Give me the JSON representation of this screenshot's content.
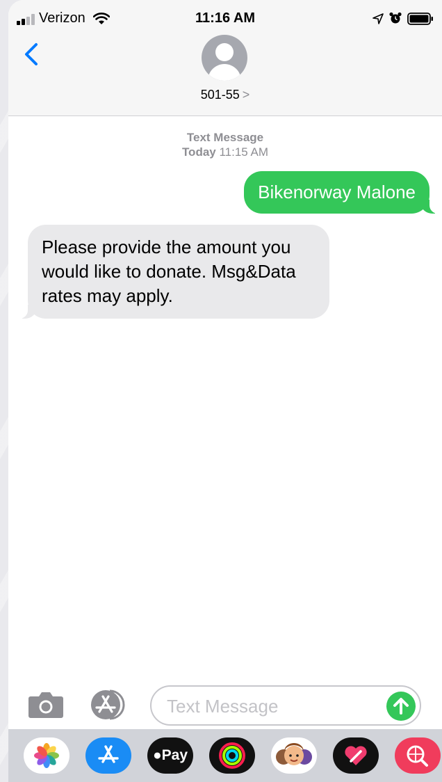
{
  "status_bar": {
    "carrier": "Verizon",
    "time": "11:16 AM"
  },
  "header": {
    "contact": "501-55",
    "chevron": ">"
  },
  "thread": {
    "service_label": "Text Message",
    "day_label": "Today",
    "timestamp": "11:15 AM",
    "messages": [
      {
        "direction": "sent",
        "text": "Bikenorway Malone"
      },
      {
        "direction": "received",
        "text": "Please provide the amount you would like to donate. Msg&Data rates may apply."
      }
    ]
  },
  "compose": {
    "placeholder": "Text Message",
    "value": ""
  },
  "app_drawer": {
    "apple_pay_label": "Pay",
    "apps": [
      "photos-icon",
      "app-store-icon",
      "apple-pay-icon",
      "activity-icon",
      "memoji-icon",
      "digital-touch-icon",
      "search-images-icon"
    ]
  },
  "colors": {
    "sent_bubble": "#34c759",
    "received_bubble": "#e9e9eb",
    "accent": "#007aff"
  }
}
